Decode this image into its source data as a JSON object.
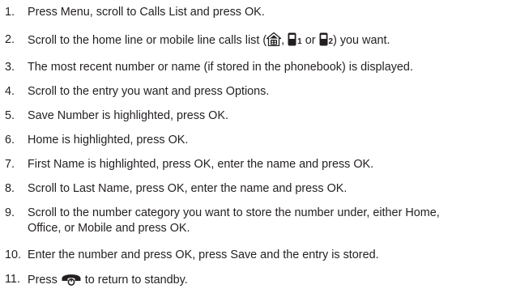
{
  "steps": [
    {
      "num": "1.",
      "parts": [
        "Press ",
        "Menu",
        ", scroll to ",
        "Calls List",
        " and press ",
        "OK",
        "."
      ]
    },
    {
      "num": "2.",
      "a": "Scroll to the home line or mobile line calls list (",
      "sep": ", ",
      "sub1": "1",
      "or": "or ",
      "sub2": "2",
      "b": ") you want."
    },
    {
      "num": "3.",
      "text": "The most recent number or name (if stored in the phonebook) is displayed."
    },
    {
      "num": "4.",
      "parts": [
        "Scroll to the entry you want and press ",
        "Options",
        "."
      ]
    },
    {
      "num": "5.",
      "parts": [
        "",
        "Save Number",
        " is highlighted, press ",
        "OK",
        "."
      ]
    },
    {
      "num": "6.",
      "parts": [
        "",
        "Home",
        " is highlighted, press ",
        "OK",
        "."
      ]
    },
    {
      "num": "7.",
      "parts": [
        "",
        "First Name",
        " is highlighted, press ",
        "OK",
        ", enter the name and press ",
        "OK",
        "."
      ]
    },
    {
      "num": "8.",
      "parts": [
        "Scroll to ",
        "Last Name",
        ", press ",
        "OK",
        ", enter the name and press ",
        "OK",
        "."
      ]
    },
    {
      "num": "9.",
      "line1": "Scroll to the number category you want to store the number under, either Home,",
      "line2": [
        "",
        "Office",
        ", or ",
        "Mobile",
        " and press ",
        "OK",
        "."
      ]
    },
    {
      "num": "10.",
      "parts": [
        "Enter the number and press ",
        "OK",
        ", press ",
        "Save",
        " and the entry is stored."
      ]
    },
    {
      "num": "11.",
      "a": "Press ",
      "b": " to return to standby."
    }
  ],
  "icons": {
    "home_line": "house-icon",
    "mobile_line": "handset-icon",
    "end_call": "phone-end-key-icon"
  },
  "colors": {
    "text": "#231f20"
  }
}
